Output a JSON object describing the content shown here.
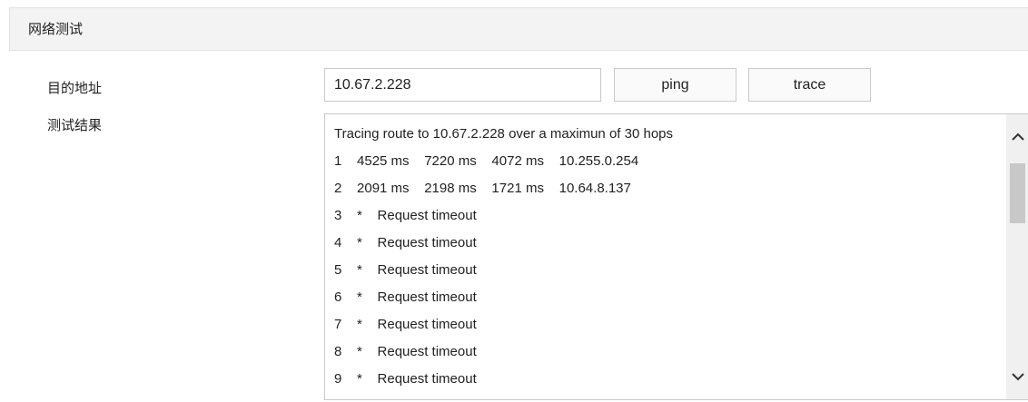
{
  "section": {
    "title": "网络测试"
  },
  "form": {
    "target_label": "目的地址",
    "result_label": "测试结果",
    "address_value": "10.67.2.228",
    "ping_label": "ping",
    "trace_label": "trace"
  },
  "result": {
    "lines": [
      "Tracing route to 10.67.2.228 over a maximun of 30 hops",
      "1    4525 ms    7220 ms    4072 ms    10.255.0.254",
      "2    2091 ms    2198 ms    1721 ms    10.64.8.137",
      "3    *    Request timeout",
      "4    *    Request timeout",
      "5    *    Request timeout",
      "6    *    Request timeout",
      "7    *    Request timeout",
      "8    *    Request timeout",
      "9    *    Request timeout"
    ]
  },
  "icons": {
    "scroll_up": "chevron-up-icon",
    "scroll_down": "chevron-down-icon"
  }
}
